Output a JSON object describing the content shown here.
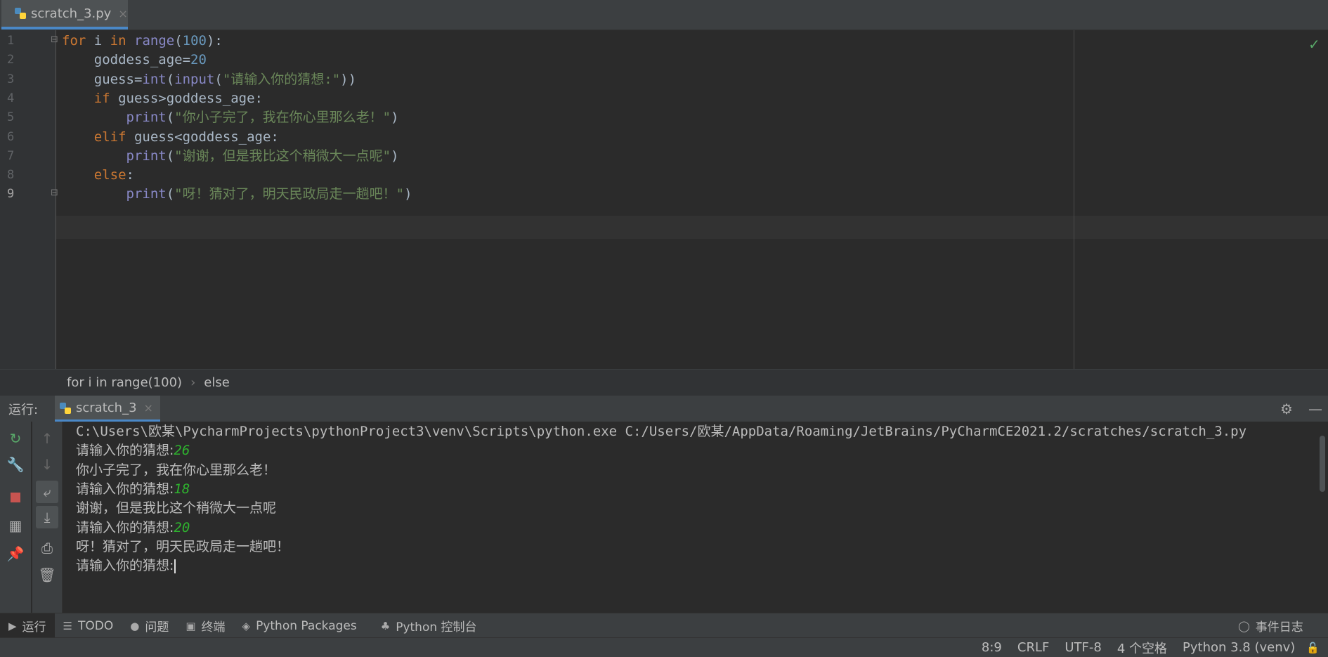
{
  "tab": {
    "filename": "scratch_3.py",
    "close": "×"
  },
  "editor": {
    "line_numbers": [
      "1",
      "2",
      "3",
      "4",
      "5",
      "6",
      "7",
      "8",
      "9"
    ],
    "lines": [
      [
        {
          "t": "for",
          "c": "kw"
        },
        {
          "t": " i ",
          "c": ""
        },
        {
          "t": "in",
          "c": "kw"
        },
        {
          "t": " ",
          "c": ""
        },
        {
          "t": "range",
          "c": "bi"
        },
        {
          "t": "(",
          "c": ""
        },
        {
          "t": "100",
          "c": "num"
        },
        {
          "t": "):",
          "c": ""
        }
      ],
      [
        {
          "t": "    goddess_age=",
          "c": ""
        },
        {
          "t": "20",
          "c": "num"
        }
      ],
      [
        {
          "t": "    guess=",
          "c": ""
        },
        {
          "t": "int",
          "c": "bi"
        },
        {
          "t": "(",
          "c": ""
        },
        {
          "t": "input",
          "c": "bi"
        },
        {
          "t": "(",
          "c": ""
        },
        {
          "t": "\"请输入你的猜想:\"",
          "c": "str"
        },
        {
          "t": "))",
          "c": ""
        }
      ],
      [
        {
          "t": "    ",
          "c": ""
        },
        {
          "t": "if",
          "c": "kw"
        },
        {
          "t": " guess>goddess_age:",
          "c": ""
        }
      ],
      [
        {
          "t": "        ",
          "c": ""
        },
        {
          "t": "print",
          "c": "bi"
        },
        {
          "t": "(",
          "c": ""
        },
        {
          "t": "\"你小子完了，我在你心里那么老！\"",
          "c": "str"
        },
        {
          "t": ")",
          "c": ""
        }
      ],
      [
        {
          "t": "    ",
          "c": ""
        },
        {
          "t": "elif",
          "c": "kw"
        },
        {
          "t": " guess<goddess_age:",
          "c": ""
        }
      ],
      [
        {
          "t": "        ",
          "c": ""
        },
        {
          "t": "print",
          "c": "bi"
        },
        {
          "t": "(",
          "c": ""
        },
        {
          "t": "\"谢谢，但是我比这个稍微大一点呢\"",
          "c": "str"
        },
        {
          "t": ")",
          "c": ""
        }
      ],
      [
        {
          "t": "    ",
          "c": ""
        },
        {
          "t": "else",
          "c": "kw"
        },
        {
          "t": ":",
          "c": ""
        }
      ],
      [
        {
          "t": "        ",
          "c": ""
        },
        {
          "t": "print",
          "c": "bi"
        },
        {
          "t": "(",
          "c": ""
        },
        {
          "t": "\"呀！猜对了，明天民政局走一趟吧！\"",
          "c": "str"
        },
        {
          "t": ")",
          "c": ""
        }
      ]
    ]
  },
  "breadcrumb": {
    "item1": "for i in range(100)",
    "sep": "›",
    "item2": "else"
  },
  "run": {
    "label": "运行:",
    "tab_name": "scratch_3",
    "tab_close": "×",
    "output": [
      {
        "text": "C:\\Users\\欧某\\PycharmProjects\\pythonProject3\\venv\\Scripts\\python.exe C:/Users/欧某/AppData/Roaming/JetBrains/PyCharmCE2021.2/scratches/scratch_3.py",
        "input": ""
      },
      {
        "text": "请输入你的猜想:",
        "input": "26"
      },
      {
        "text": "你小子完了，我在你心里那么老！",
        "input": ""
      },
      {
        "text": "请输入你的猜想:",
        "input": "18"
      },
      {
        "text": "谢谢，但是我比这个稍微大一点呢",
        "input": ""
      },
      {
        "text": "请输入你的猜想:",
        "input": "20"
      },
      {
        "text": "呀！猜对了，明天民政局走一趟吧！",
        "input": ""
      },
      {
        "text": "请输入你的猜想:",
        "input": ""
      }
    ]
  },
  "toolwindows": {
    "run": "运行",
    "todo": "TODO",
    "problems": "问题",
    "terminal": "终端",
    "packages": "Python Packages",
    "console": "Python 控制台",
    "event_log": "事件日志"
  },
  "status": {
    "position": "8:9",
    "line_sep": "CRLF",
    "encoding": "UTF-8",
    "indent": "4 个空格",
    "interpreter": "Python 3.8 (venv)"
  },
  "colors": {
    "accent": "#4a88c7",
    "input_green": "#2eb32e",
    "keyword": "#cc7832",
    "string": "#6a8759"
  }
}
